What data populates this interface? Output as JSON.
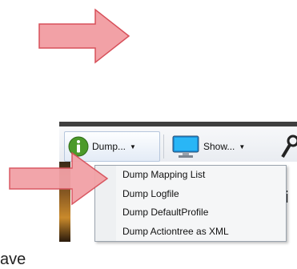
{
  "colors": {
    "arrow_fill": "#f2a1a6",
    "arrow_stroke": "#d7505a",
    "menu_bg": "#f5f6f7",
    "menu_border": "#9aa3ad"
  },
  "toolbar": {
    "dump_button": {
      "label": "Dump...",
      "icon": "info-icon"
    },
    "show_button": {
      "label": "Show...",
      "icon": "monitor-icon"
    },
    "search_icon": "magnifier-icon"
  },
  "menu": {
    "items": [
      {
        "label": "Dump Mapping List"
      },
      {
        "label": "Dump Logfile"
      },
      {
        "label": "Dump DefaultProfile"
      },
      {
        "label": "Dump Actiontree as XML"
      }
    ]
  },
  "background_text": {
    "partial_right": "i",
    "bottom_left": "ave"
  }
}
